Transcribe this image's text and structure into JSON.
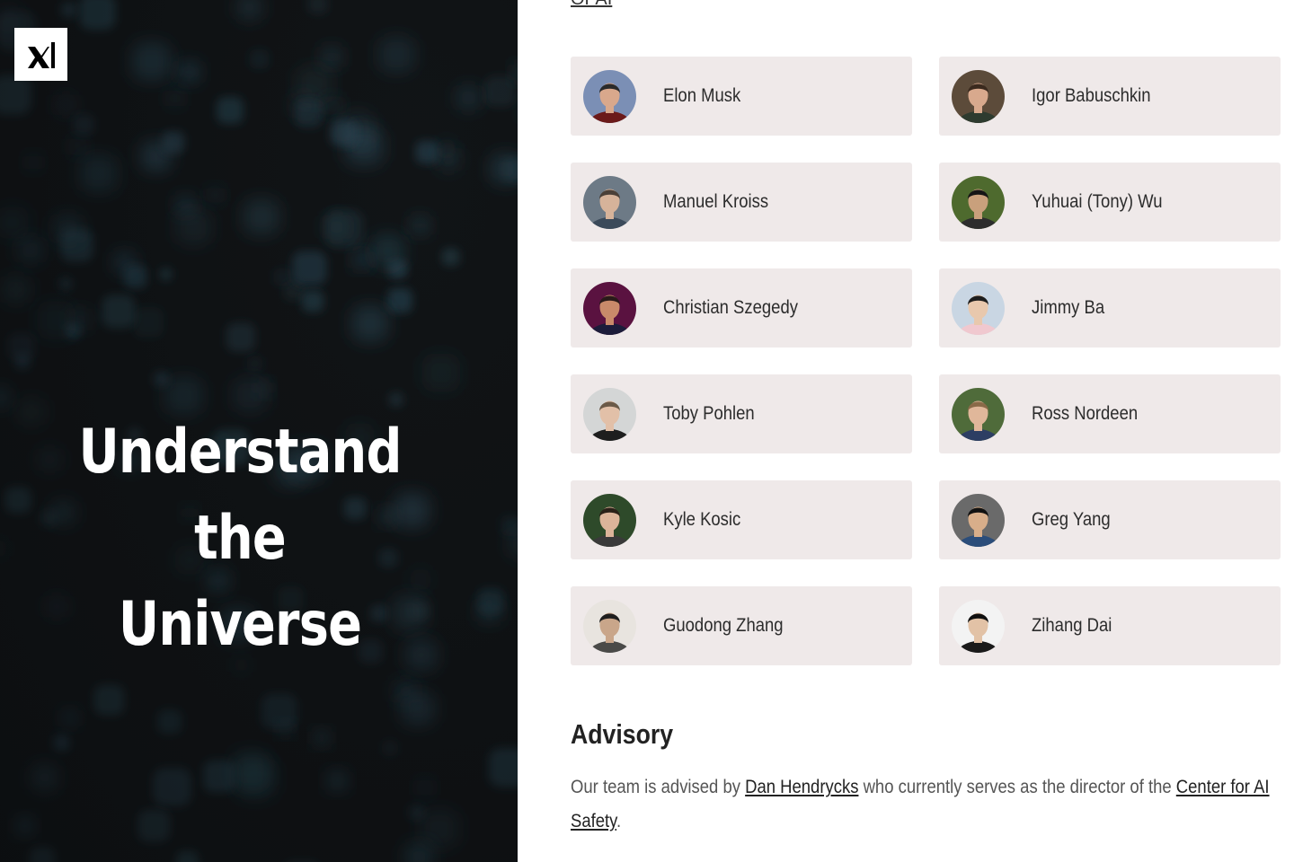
{
  "brand": {
    "logo_icon": "xai-logo-icon"
  },
  "hero": {
    "title_line1": "Understand the",
    "title_line2": "Universe"
  },
  "top_link": {
    "text": "OPAI"
  },
  "team": [
    {
      "name": "Elon Musk",
      "avatar_color": "#7b8fb5",
      "skin": "#d9a88c",
      "hair": "#2a2a2a",
      "shirt": "#6b1a1a"
    },
    {
      "name": "Igor Babuschkin",
      "avatar_color": "#5c4b3a",
      "skin": "#d8a98d",
      "hair": "#3a2a1e",
      "shirt": "#2e3b2f"
    },
    {
      "name": "Manuel Kroiss",
      "avatar_color": "#6d7a86",
      "skin": "#d6b39a",
      "hair": "#4a4038",
      "shirt": "#3b4a5a"
    },
    {
      "name": "Yuhuai (Tony) Wu",
      "avatar_color": "#4e6a2e",
      "skin": "#c9a07c",
      "hair": "#151515",
      "shirt": "#2d2d2d"
    },
    {
      "name": "Christian Szegedy",
      "avatar_color": "#5a1240",
      "skin": "#c98a6a",
      "hair": "#2a1a1a",
      "shirt": "#1c1c3a"
    },
    {
      "name": "Jimmy Ba",
      "avatar_color": "#c9d6e3",
      "skin": "#e8c8ad",
      "hair": "#1d1d1d",
      "shirt": "#f0c8cf"
    },
    {
      "name": "Toby Pohlen",
      "avatar_color": "#d4d6d6",
      "skin": "#e2c0a8",
      "hair": "#6b5a48",
      "shirt": "#1e1e1e"
    },
    {
      "name": "Ross Nordeen",
      "avatar_color": "#4f6b3a",
      "skin": "#e0b79a",
      "hair": "#8a6a48",
      "shirt": "#2d3e63"
    },
    {
      "name": "Kyle Kosic",
      "avatar_color": "#2e4a2a",
      "skin": "#dcb49a",
      "hair": "#2a2018",
      "shirt": "#3a3a3a"
    },
    {
      "name": "Greg Yang",
      "avatar_color": "#6a6a6a",
      "skin": "#d8ae8a",
      "hair": "#111111",
      "shirt": "#2b4d7a"
    },
    {
      "name": "Guodong Zhang",
      "avatar_color": "#e8e4df",
      "skin": "#c9a68a",
      "hair": "#1e1e1e",
      "shirt": "#4a4a48"
    },
    {
      "name": "Zihang Dai",
      "avatar_color": "#f3f3f3",
      "skin": "#e2c2a6",
      "hair": "#101010",
      "shirt": "#1a1a1a"
    }
  ],
  "advisory": {
    "title": "Advisory",
    "text_before": "Our team is advised by ",
    "link1": "Dan Hendrycks",
    "text_middle": " who currently serves as the director of the ",
    "link2": "Center for AI Safety",
    "text_after": "."
  },
  "colors": {
    "hero_bg": "#101214",
    "card_bg": "#efe9e9",
    "accent_blob": "#2a4a58"
  }
}
